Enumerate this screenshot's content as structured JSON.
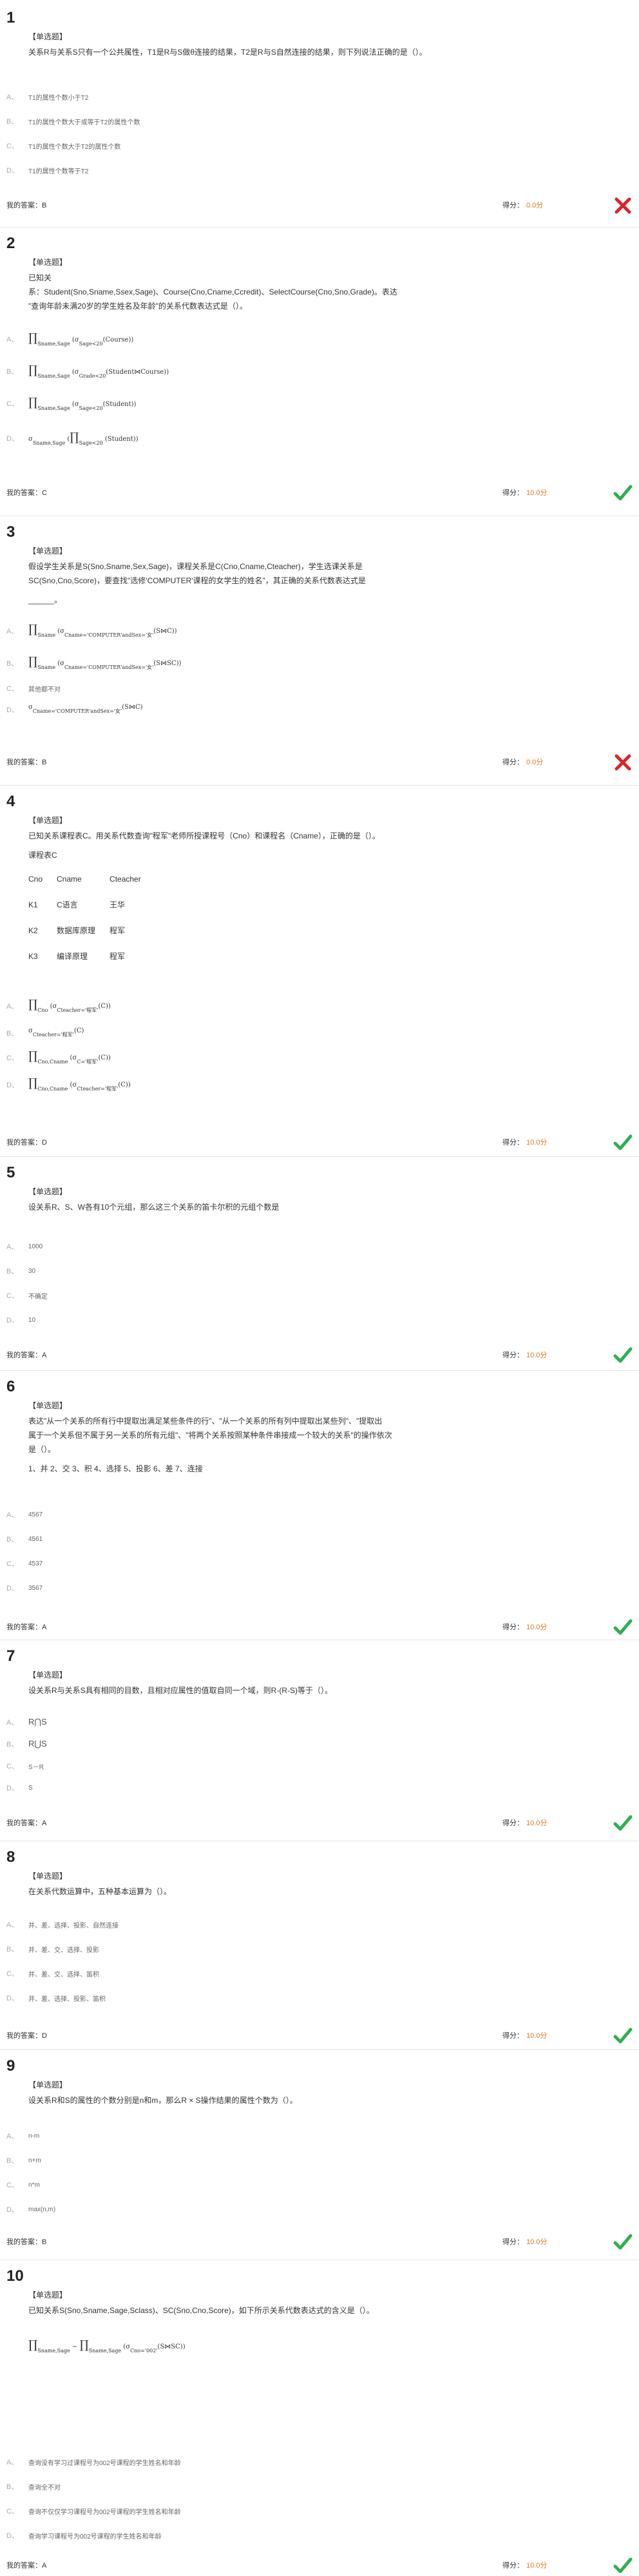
{
  "questions": [
    {
      "num": "1",
      "type": "【单选题】",
      "text": "关系R与关系S只有一个公共属性，T1是R与S做θ连接的结果，T2是R与S自然连接的结果，则下列说法正确的是（）。",
      "options": [
        {
          "letter": "A、",
          "text": "T1的属性个数小于T2"
        },
        {
          "letter": "B、",
          "text": "T1的属性个数大于或等于T2的属性个数"
        },
        {
          "letter": "C、",
          "text": "T1的属性个数大于T2的属性个数"
        },
        {
          "letter": "D、",
          "text": "T1的属性个数等于T2"
        }
      ],
      "answer_label": "我的答案：",
      "answer": "B",
      "score_label": "得分：",
      "score": "0.0分",
      "correct": false
    },
    {
      "num": "2",
      "type": "【单选题】",
      "text_l1": "已知关",
      "text_l2": "系：Student(Sno,Sname,Ssex,Sage)、Course(Cno,Cname,Ccredit)、SelectCourse(Cno,Sno,Grade)。表达",
      "text_l3": "\"查询年龄未满20岁的学生姓名及年龄\"的关系代数表达式是（）。",
      "options": [
        {
          "letter": "A、",
          "sub": "Sname,Sage",
          "inner": "σ",
          "cond": "Sage<20",
          "rel": "(Course))"
        },
        {
          "letter": "B、",
          "sub": "Sname,Sage",
          "inner": "σ",
          "cond": "Grade<20",
          "rel": "(Student⋈Course))"
        },
        {
          "letter": "C、",
          "sub": "Sname,Sage",
          "inner": "σ",
          "cond": "Sage<20",
          "rel": "(Student))"
        },
        {
          "letter": "D、",
          "pre": "σ",
          "precond": "Sname,Sage",
          "sub": "Sage<20",
          "rel": "(Student)"
        }
      ],
      "answer_label": "我的答案：",
      "answer": "C",
      "score_label": "得分：",
      "score": "10.0分",
      "correct": true
    },
    {
      "num": "3",
      "type": "【单选题】",
      "text_l1": "假设学生关系是S(Sno,Sname,Sex,Sage)，课程关系是C(Cno,Cname,Cteacher)，学生选课关系是",
      "text_l2": "SC(Sno,Cno,Score)，要查找\"选修'COMPUTER'课程的女学生的姓名\"，其正确的关系代数表达式是",
      "text_l3": "______。",
      "options": [
        {
          "letter": "A、",
          "sub": "Sname",
          "cond": "Cname='COMPUTER'andSex='女'",
          "rel": "(S⋈C))"
        },
        {
          "letter": "B、",
          "sub": "Sname",
          "cond": "Cname='COMPUTER'andSex='女'",
          "rel": "(S⋈SC))"
        },
        {
          "letter": "C、",
          "text": "其他都不对"
        },
        {
          "letter": "D、",
          "cond": "Cname='COMPUTER'andSex='女'",
          "rel": "(S⋈C)"
        }
      ],
      "answer_label": "我的答案：",
      "answer": "B",
      "score_label": "得分：",
      "score": "0.0分",
      "correct": false
    },
    {
      "num": "4",
      "type": "【单选题】",
      "text_l1": "已知关系课程表C。用关系代数查询\"程军\"老师所授课程号（Cno）和课程名（Cname），正确的是（）。",
      "text_l2": "课程表C",
      "table": [
        [
          "Cno",
          "Cname",
          "Cteacher"
        ],
        [
          "K1",
          "C语言",
          "王华"
        ],
        [
          "K2",
          "数据库原理",
          "程军"
        ],
        [
          "K3",
          "编译原理",
          "程军"
        ]
      ],
      "options": [
        {
          "letter": "A、",
          "sub": "Cno",
          "cond": "Cteacher='程军'",
          "rel": "(C))"
        },
        {
          "letter": "B、",
          "cond": "Cteacher='程军'",
          "rel": "(C)"
        },
        {
          "letter": "C、",
          "sub": "Cno,Cname",
          "cond": "C='程军'",
          "rel": "(C))"
        },
        {
          "letter": "D、",
          "sub": "Cno,Cname",
          "cond": "Cteacher='程军'",
          "rel": "(C))"
        }
      ],
      "answer_label": "我的答案：",
      "answer": "D",
      "score_label": "得分：",
      "score": "10.0分",
      "correct": true
    },
    {
      "num": "5",
      "type": "【单选题】",
      "text": "设关系R、S、W各有10个元组，那么这三个关系的笛卡尔积的元组个数是",
      "options": [
        {
          "letter": "A、",
          "text": "1000"
        },
        {
          "letter": "B、",
          "text": "30"
        },
        {
          "letter": "C、",
          "text": "不确定"
        },
        {
          "letter": "D、",
          "text": "10"
        }
      ],
      "answer_label": "我的答案：",
      "answer": "A",
      "score_label": "得分：",
      "score": "10.0分",
      "correct": true
    },
    {
      "num": "6",
      "type": "【单选题】",
      "text_l1": "表达\"从一个关系的所有行中提取出满足某些条件的行\"、\"从一个关系的所有列中提取出某些列\"、\"提取出",
      "text_l2": "属于一个关系但不属于另一关系的所有元组\"、\"将两个关系按照某种条件串接成一个较大的关系\"的操作依次",
      "text_l3": "是（）。",
      "text_l4": "1、并 2、交 3、积 4、选择 5、投影 6、差 7、连接",
      "options": [
        {
          "letter": "A、",
          "text": "4567"
        },
        {
          "letter": "B、",
          "text": "4561"
        },
        {
          "letter": "C、",
          "text": "4537"
        },
        {
          "letter": "D、",
          "text": "3567"
        }
      ],
      "answer_label": "我的答案：",
      "answer": "A",
      "score_label": "得分：",
      "score": "10.0分",
      "correct": true
    },
    {
      "num": "7",
      "type": "【单选题】",
      "text": "设关系R与关系S具有相同的目数，且相对应属性的值取自同一个域，则R-(R-S)等于（）。",
      "options": [
        {
          "letter": "A、",
          "text": "R⋂S"
        },
        {
          "letter": "B、",
          "text": "R⋃S"
        },
        {
          "letter": "C、",
          "text": "S－R"
        },
        {
          "letter": "D、",
          "text": "S"
        }
      ],
      "answer_label": "我的答案：",
      "answer": "A",
      "score_label": "得分：",
      "score": "10.0分",
      "correct": true
    },
    {
      "num": "8",
      "type": "【单选题】",
      "text": "在关系代数运算中，五种基本运算为（）。",
      "options": [
        {
          "letter": "A、",
          "text": "并、差、选择、投影、自然连接"
        },
        {
          "letter": "B、",
          "text": "并、差、交、选择、投影"
        },
        {
          "letter": "C、",
          "text": "并、差、交、选择、笛积"
        },
        {
          "letter": "D、",
          "text": "并、差、选择、投影、笛积"
        }
      ],
      "answer_label": "我的答案：",
      "answer": "D",
      "score_label": "得分：",
      "score": "10.0分",
      "correct": true
    },
    {
      "num": "9",
      "type": "【单选题】",
      "text": "设关系R和S的属性的个数分别是n和m，那么R × S操作结果的属性个数为（）。",
      "options": [
        {
          "letter": "A、",
          "text": "n-m"
        },
        {
          "letter": "B、",
          "text": "n+m"
        },
        {
          "letter": "C、",
          "text": "n*m"
        },
        {
          "letter": "D、",
          "text": "max(n,m)"
        }
      ],
      "answer_label": "我的答案：",
      "answer": "B",
      "score_label": "得分：",
      "score": "10.0分",
      "correct": true
    },
    {
      "num": "10",
      "type": "【单选题】",
      "text": "已知关系S(Sno,Sname,Sage,Sclass)、SC(Sno,Cno,Score)，如下所示关系代数表达式的含义是（）。",
      "formula": {
        "sub1": "Sname,Sage",
        "minus": "−",
        "sub2": "Sname,Sage",
        "cond": "Cno='002'",
        "rel": "(S⋈SC)"
      },
      "options": [
        {
          "letter": "A、",
          "text": "查询没有学习过课程号为002号课程的学生姓名和年龄"
        },
        {
          "letter": "B、",
          "text": "查询全不对"
        },
        {
          "letter": "C、",
          "text": "查询不仅仅学习课程号为002号课程的学生姓名和年龄"
        },
        {
          "letter": "D、",
          "text": "查询学习课程号为002号课程的学生姓名和年龄"
        }
      ],
      "answer_label": "我的答案：",
      "answer": "A",
      "score_label": "得分：",
      "score": "10.0分",
      "correct": true
    }
  ],
  "colors": {
    "score": "#e77818",
    "correct": "#2eaf4f",
    "wrong": "#d9242a"
  }
}
